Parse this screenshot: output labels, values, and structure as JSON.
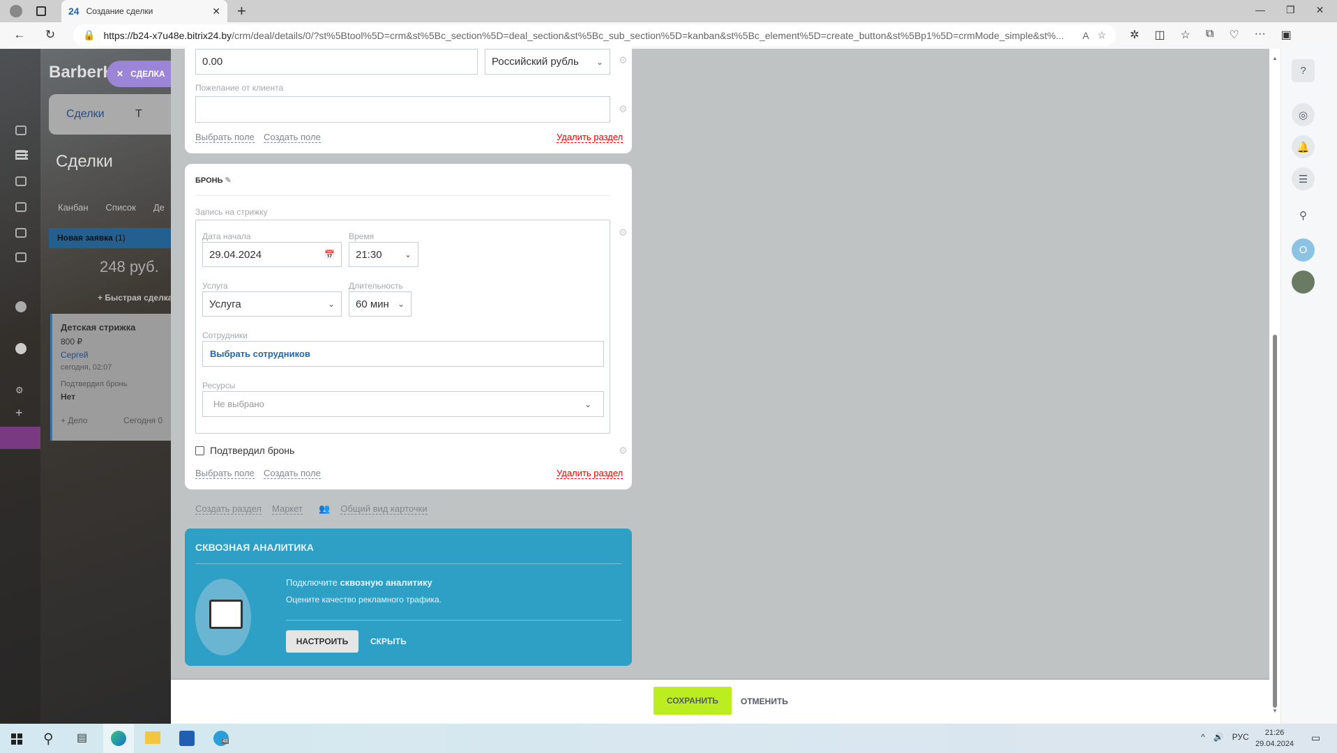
{
  "browser": {
    "tab_icon": "24",
    "tab_title": "Создание сделки",
    "url_host": "https://b24-x7u48e.bitrix24.by",
    "url_path": "/crm/deal/details/0/?st%5Btool%5D=crm&st%5Bc_section%5D=deal_section&st%5Bc_sub_section%5D=kanban&st%5Bc_element%5D=create_button&st%5Bp1%5D=crmMode_simple&st%..."
  },
  "background": {
    "portal": "BarberH",
    "slider_label": "СДЕЛКА",
    "tab_deals": "Сделки",
    "tab_t": "Т",
    "page_title": "Сделки",
    "view_kanban": "Канбан",
    "view_list": "Список",
    "view_more": "Де",
    "stage": "Новая заявка",
    "stage_count": "(1)",
    "stage_sum": "248 руб.",
    "quick_deal": "Быстрая сделка",
    "deal": {
      "title": "Детская стрижка",
      "price": "800 ₽",
      "client": "Сергей",
      "date": "сегодня, 02:07",
      "field_label": "Подтвердил бронь",
      "field_value": "Нет",
      "add_task": "+ Дело",
      "today": "Сегодня 0"
    }
  },
  "card1": {
    "amount": "0.00",
    "currency": "Российский рубль",
    "wish_label": "Пожелание от клиента",
    "wish_value": "",
    "select_field": "Выбрать поле",
    "create_field": "Создать поле",
    "delete_section": "Удалить раздел"
  },
  "card2": {
    "title": "БРОНЬ",
    "booking_label": "Запись на стрижку",
    "date_label": "Дата начала",
    "date_value": "29.04.2024",
    "time_label": "Время",
    "time_value": "21:30",
    "service_label": "Услуга",
    "service_value": "Услуга",
    "duration_label": "Длительность",
    "duration_value": "60 мин",
    "staff_label": "Сотрудники",
    "staff_value": "Выбрать сотрудников",
    "resources_label": "Ресурсы",
    "resources_value": "Не выбрано",
    "confirm_label": "Подтвердил бронь",
    "select_field": "Выбрать поле",
    "create_field": "Создать поле",
    "delete_section": "Удалить раздел"
  },
  "bottom_links": {
    "create_section": "Создать раздел",
    "market": "Маркет",
    "common_view": "Общий вид карточки"
  },
  "analytics": {
    "title": "СКВОЗНАЯ АНАЛИТИКА",
    "text_prefix": "Подключите ",
    "text_bold": "сквозную аналитику",
    "subtext": "Оцените качество рекламного трафика.",
    "setup": "НАСТРОИТЬ",
    "hide": "СКРЫТЬ"
  },
  "footer": {
    "save": "СОХРАНИТЬ",
    "cancel": "ОТМЕНИТЬ"
  },
  "right_panel": {
    "avatar_letter": "О"
  },
  "taskbar": {
    "lang": "РУС",
    "time": "21:26",
    "date": "29.04.2024",
    "telegram_badge": "48"
  },
  "colors": {
    "accent": "#2067b0",
    "save": "#bbed21",
    "analytics": "#2e9fc5",
    "delete": "#e00000"
  }
}
